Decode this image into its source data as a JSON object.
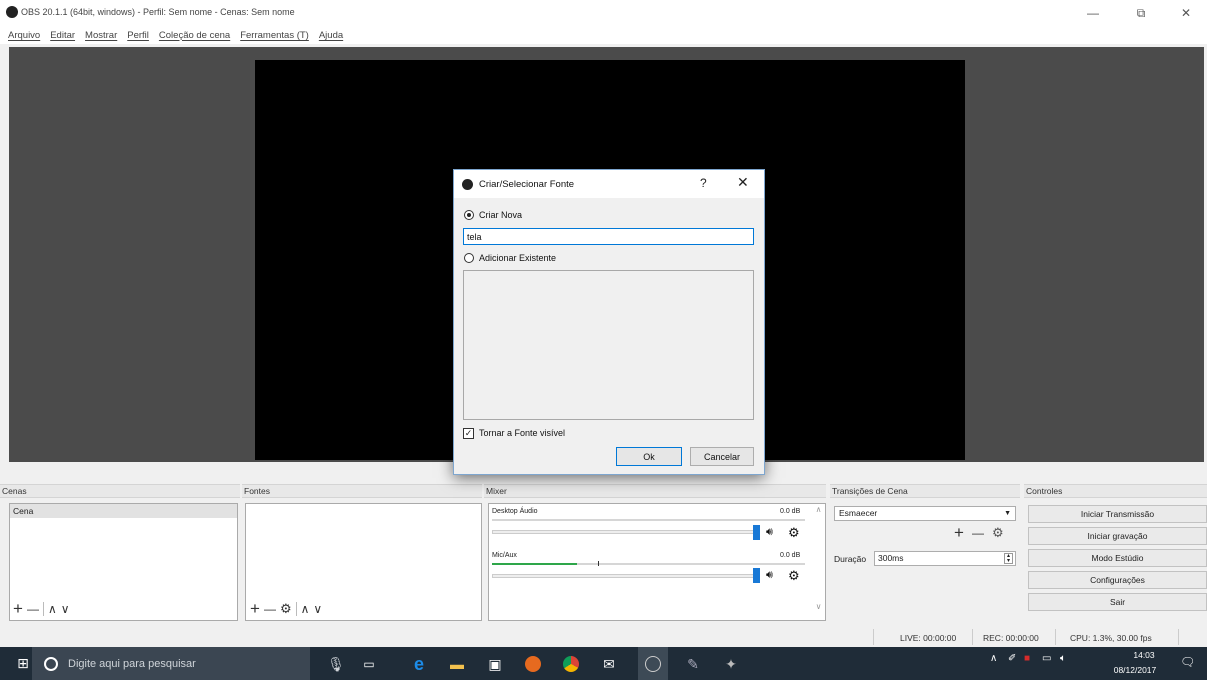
{
  "window": {
    "title": "OBS 20.1.1 (64bit, windows) - Perfil: Sem nome - Cenas: Sem nome",
    "minimize_glyph": "—",
    "maximize_glyph": "⧉",
    "close_glyph": "✕"
  },
  "menu": [
    "Arquivo",
    "Editar",
    "Mostrar",
    "Perfil",
    "Coleção de cena",
    "Ferramentas (T)",
    "Ajuda"
  ],
  "docks": {
    "scenes": {
      "title": "Cenas",
      "items": [
        "Cena"
      ],
      "add": "+",
      "remove": "—",
      "up": "∧",
      "down": "∨"
    },
    "sources": {
      "title": "Fontes",
      "add": "+",
      "remove": "—",
      "settings": "⚙",
      "up": "∧",
      "down": "∨"
    },
    "mixer": {
      "title": "Mixer",
      "channels": [
        {
          "name": "Desktop Áudio",
          "db": "0.0 dB",
          "level": 0.0,
          "volume": 1.0
        },
        {
          "name": "Mic/Aux",
          "db": "0.0 dB",
          "level": 0.27,
          "volume": 1.0
        }
      ]
    },
    "transitions": {
      "title": "Transições de Cena",
      "selected": "Esmaecer",
      "add": "+",
      "remove": "—",
      "duration_label": "Duração",
      "duration_value": "300ms"
    },
    "controls": {
      "title": "Controles",
      "buttons": [
        "Iniciar Transmissão",
        "Iniciar gravação",
        "Modo Estúdio",
        "Configurações",
        "Sair"
      ]
    }
  },
  "status": {
    "live": "LIVE: 00:00:00",
    "rec": "REC: 00:00:00",
    "cpu": "CPU: 1.3%, 30.00 fps"
  },
  "dialog": {
    "title": "Criar/Selecionar Fonte",
    "help": "?",
    "close": "✕",
    "create_new_label": "Criar Nova",
    "name_value": "tela",
    "add_existing_label": "Adicionar Existente",
    "visible_label": "Tornar a Fonte visível",
    "visible_checked": true,
    "ok_label": "Ok",
    "cancel_label": "Cancelar"
  },
  "taskbar": {
    "search_placeholder": "Digite aqui para pesquisar",
    "time": "14:03",
    "date": "08/12/2017"
  },
  "colors": {
    "accent": "#1979d6",
    "preview_bg": "#4b4b4b",
    "taskbar_bg": "#1f2c38",
    "meter_green": "#2ea64a"
  }
}
